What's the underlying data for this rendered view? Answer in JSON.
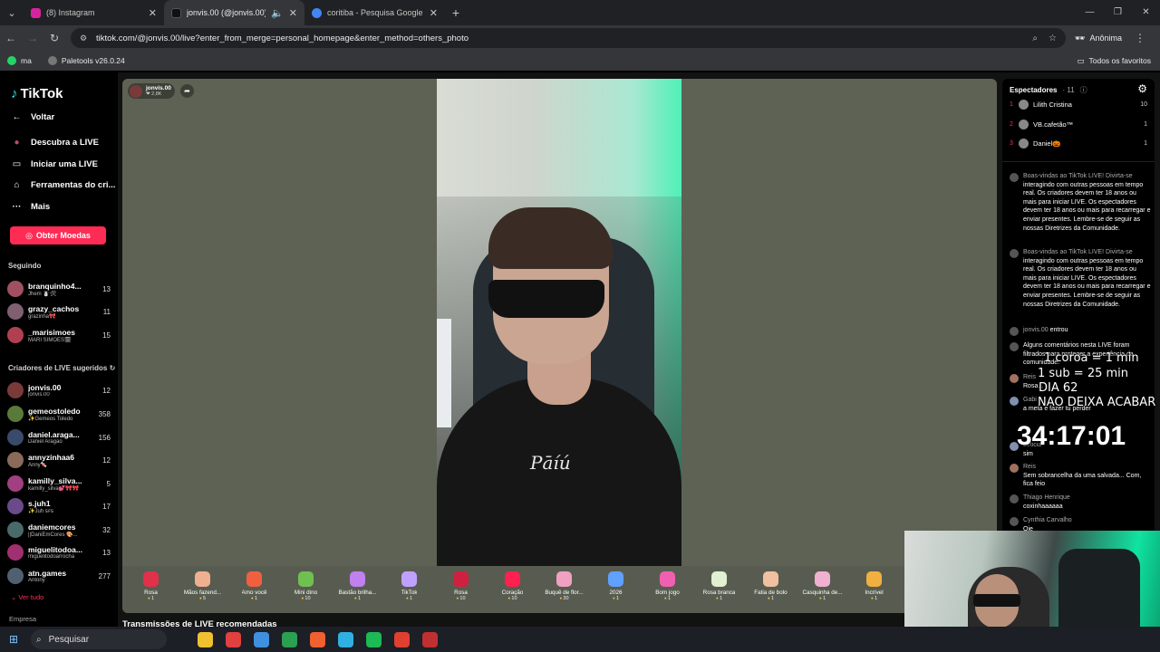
{
  "browser": {
    "tabs": [
      {
        "title": "(8) Instagram",
        "favicon_color": "#d6249f",
        "active": false
      },
      {
        "title": "jonvis.00 (@jonvis.00) com...",
        "favicon_color": "#111111",
        "active": true
      },
      {
        "title": "coritiba - Pesquisa Google",
        "favicon_color": "#4285f4",
        "active": false
      }
    ],
    "url": "tiktok.com/@jonvis.00/live?enter_from_merge=personal_homepage&enter_method=others_photo",
    "profile_label": "Anônima",
    "bookmarks": [
      {
        "label": "ma",
        "color": "#25d366"
      },
      {
        "label": "Paletools v26.0.24",
        "color": "#777777"
      }
    ],
    "all_favorites": "Todos os favoritos"
  },
  "sidebar": {
    "logo": "TikTok",
    "nav": [
      {
        "label": "Voltar",
        "icon": "arrow-left-icon",
        "glyph": "←"
      },
      {
        "label": "Descubra a LIVE",
        "icon": "avatar-icon",
        "glyph": "●"
      },
      {
        "label": "Iniciar uma LIVE",
        "icon": "camera-icon",
        "glyph": "▭"
      },
      {
        "label": "Ferramentas do cri...",
        "icon": "home-icon",
        "glyph": "⌂"
      },
      {
        "label": "Mais",
        "icon": "more-icon",
        "glyph": "···"
      }
    ],
    "coins_button": "Obter Moedas",
    "following_title": "Seguindo",
    "following": [
      {
        "user": "branquinho4...",
        "display": "Jhem ☃️🛠",
        "count": "13",
        "color": "#a05060"
      },
      {
        "user": "grazy_cachos",
        "display": "grazinha🎀",
        "count": "11",
        "color": "#806070"
      },
      {
        "user": "_marisimoes",
        "display": "MARI SIMÕES🎬",
        "count": "15",
        "color": "#b04050"
      }
    ],
    "creators_title": "Criadores de LIVE sugeridos",
    "creators": [
      {
        "user": "jonvis.00",
        "display": "jonvis.00",
        "count": "12",
        "color": "#7a3a3a"
      },
      {
        "user": "gemeostoledo",
        "display": "✨Gemeos Toledo",
        "count": "358",
        "color": "#5a7a3a"
      },
      {
        "user": "daniel.araga...",
        "display": "Daniel Aragão",
        "count": "156",
        "color": "#3a4a6a"
      },
      {
        "user": "annyzinhaa6",
        "display": "Anny🍬",
        "count": "12",
        "color": "#8a6a5a"
      },
      {
        "user": "kamilly_silva...",
        "display": "kamilly_silva💕🎀🎀",
        "count": "5",
        "color": "#a04080"
      },
      {
        "user": "s.juh1",
        "display": "✨Juh ꜱꜰꜱ",
        "count": "17",
        "color": "#6a4a8a"
      },
      {
        "user": "daniemcores",
        "display": "||DaniEmCores 🎨...",
        "count": "32",
        "color": "#4a6a6a"
      },
      {
        "user": "miguelitodoa...",
        "display": "miguelitodoarrocha",
        "count": "13",
        "color": "#a03070"
      },
      {
        "user": "atn.games",
        "display": "Antony",
        "count": "277",
        "color": "#506070"
      }
    ],
    "see_all": "⌄ Ver tudo",
    "company": "Empresa"
  },
  "stream": {
    "host_name": "jonvis.00",
    "host_views": "❤ 2,8K",
    "shirt_text": "Pāíú",
    "gifts": [
      {
        "name": "Rosa",
        "price": "1",
        "color": "#e0304a"
      },
      {
        "name": "Mãos fazend...",
        "price": "5",
        "color": "#f0b090"
      },
      {
        "name": "Amo você",
        "price": "1",
        "color": "#f06040"
      },
      {
        "name": "Mini dino",
        "price": "10",
        "color": "#70c050"
      },
      {
        "name": "Bastão brilha...",
        "price": "1",
        "color": "#c080f0"
      },
      {
        "name": "TikTok",
        "price": "1",
        "color": "#c0a0ff"
      },
      {
        "name": "Rosa",
        "price": "10",
        "color": "#d02040"
      },
      {
        "name": "Coração",
        "price": "10",
        "color": "#ff2050"
      },
      {
        "name": "Buquê de flor...",
        "price": "30",
        "color": "#f0a0c0"
      },
      {
        "name": "2026",
        "price": "1",
        "color": "#60a0ff"
      },
      {
        "name": "Bom jogo",
        "price": "1",
        "color": "#f060b0"
      },
      {
        "name": "Rosa branca",
        "price": "1",
        "color": "#e0f0d0"
      },
      {
        "name": "Fatia de bolo",
        "price": "1",
        "color": "#f0c0a0"
      },
      {
        "name": "Casquinha de...",
        "price": "1",
        "color": "#f0b0d0"
      },
      {
        "name": "Incrível",
        "price": "1",
        "color": "#f0b040"
      }
    ],
    "recommended_title": "Transmissões de LIVE recomendadas"
  },
  "panel": {
    "title": "Espectadores",
    "count": "· 11",
    "viewers": [
      {
        "rank": "1",
        "name": "Lilith Cristina",
        "score": "10"
      },
      {
        "rank": "2",
        "name": "VB.cafetão™",
        "score": "1"
      },
      {
        "rank": "3",
        "name": "Daniel🎃",
        "score": "1"
      }
    ],
    "chat": [
      {
        "user": "Boas-vindas ao TikTok LIVE! Divirta-se",
        "text": "interagindo com outras pessoas em tempo real. Os criadores devem ter 18 anos ou mais para iniciar LIVE. Os espectadores devem ter 18 anos ou mais para recarregar e enviar presentes. Lembre-se de seguir as nossas Diretrizes da Comunidade."
      },
      {
        "user": "Boas-vindas ao TikTok LIVE! Divirta-se",
        "text": "interagindo com outras pessoas em tempo real. Os criadores devem ter 18 anos ou mais para iniciar LIVE. Os espectadores devem ter 18 anos ou mais para recarregar e enviar presentes. Lembre-se de seguir as nossas Diretrizes da Comunidade."
      },
      {
        "user": "jonvis.00",
        "text": "entrou"
      },
      {
        "user": "",
        "text": "Alguns comentários nesta LIVE foram filtrados para proteger a experiência da comunidade."
      },
      {
        "user": "Reis",
        "text": "Rosa..."
      },
      {
        "user": "Gabi",
        "text": "a meta e fazer tu perder"
      },
      {
        "user": "Leticia",
        "text": "sim"
      },
      {
        "user": "Reis",
        "text": "Sem sobrancelha da uma salvada... Com, fica feio"
      },
      {
        "user": "Thiago Henrique",
        "text": "coxinhaaaaaa"
      },
      {
        "user": "Cynthia Carvalho",
        "text": "Oie"
      }
    ]
  },
  "overlay": {
    "line1": "1 coroa = 1 min",
    "line2": "1 sub = 25 min",
    "line3": "DIA 62",
    "line4": "NAO DEIXA ACABAR",
    "timer": "34:17:01"
  },
  "taskbar": {
    "search_placeholder": "Pesquisar",
    "apps": [
      "#f0c030",
      "#e04040",
      "#4090e0",
      "#2aa050",
      "#f06030",
      "#30b0e0",
      "#1db954",
      "#e04030",
      "#c03030"
    ]
  }
}
